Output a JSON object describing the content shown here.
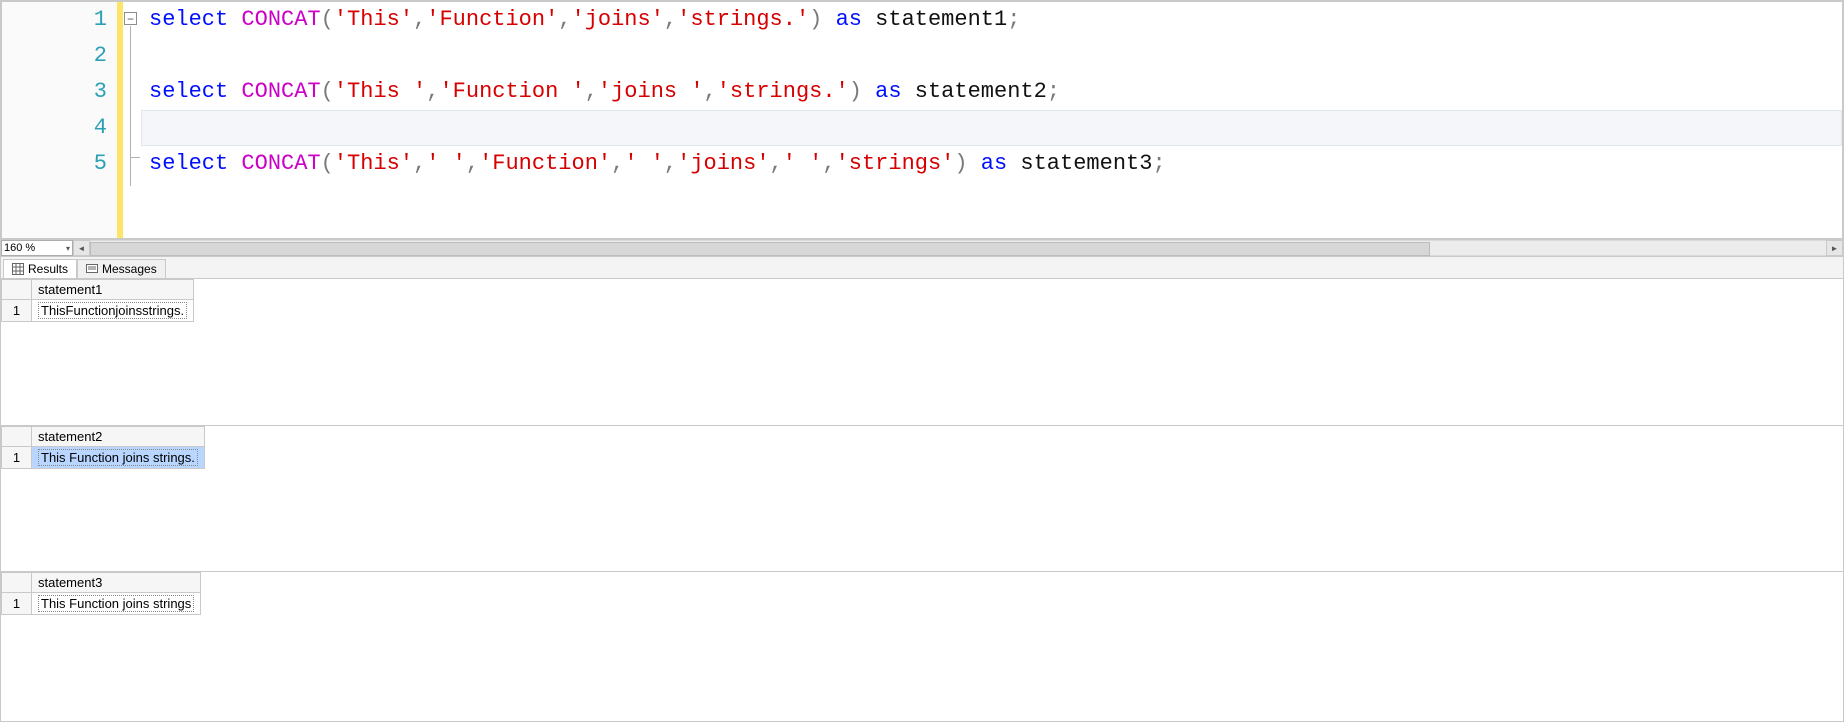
{
  "editor": {
    "zoom": "160 %",
    "fold_icon": "−",
    "lines": [
      {
        "n": "1",
        "tokens": [
          {
            "t": "select",
            "c": "kw"
          },
          {
            "t": " ",
            "c": ""
          },
          {
            "t": "CONCAT",
            "c": "fn"
          },
          {
            "t": "(",
            "c": "pn"
          },
          {
            "t": "'This'",
            "c": "str"
          },
          {
            "t": ",",
            "c": "pn"
          },
          {
            "t": "'Function'",
            "c": "str"
          },
          {
            "t": ",",
            "c": "pn"
          },
          {
            "t": "'joins'",
            "c": "str"
          },
          {
            "t": ",",
            "c": "pn"
          },
          {
            "t": "'strings.'",
            "c": "str"
          },
          {
            "t": ")",
            "c": "pn"
          },
          {
            "t": " ",
            "c": ""
          },
          {
            "t": "as",
            "c": "kw"
          },
          {
            "t": " ",
            "c": ""
          },
          {
            "t": "statement1",
            "c": "id"
          },
          {
            "t": ";",
            "c": "op"
          }
        ]
      },
      {
        "n": "2",
        "tokens": []
      },
      {
        "n": "3",
        "tokens": [
          {
            "t": "select",
            "c": "kw"
          },
          {
            "t": " ",
            "c": ""
          },
          {
            "t": "CONCAT",
            "c": "fn"
          },
          {
            "t": "(",
            "c": "pn"
          },
          {
            "t": "'This '",
            "c": "str"
          },
          {
            "t": ",",
            "c": "pn"
          },
          {
            "t": "'Function '",
            "c": "str"
          },
          {
            "t": ",",
            "c": "pn"
          },
          {
            "t": "'joins '",
            "c": "str"
          },
          {
            "t": ",",
            "c": "pn"
          },
          {
            "t": "'strings.'",
            "c": "str"
          },
          {
            "t": ")",
            "c": "pn"
          },
          {
            "t": " ",
            "c": ""
          },
          {
            "t": "as",
            "c": "kw"
          },
          {
            "t": " ",
            "c": ""
          },
          {
            "t": "statement2",
            "c": "id"
          },
          {
            "t": ";",
            "c": "op"
          }
        ]
      },
      {
        "n": "4",
        "tokens": [],
        "current": true
      },
      {
        "n": "5",
        "tokens": [
          {
            "t": "select",
            "c": "kw"
          },
          {
            "t": " ",
            "c": ""
          },
          {
            "t": "CONCAT",
            "c": "fn"
          },
          {
            "t": "(",
            "c": "pn"
          },
          {
            "t": "'This'",
            "c": "str"
          },
          {
            "t": ",",
            "c": "pn"
          },
          {
            "t": "' '",
            "c": "str"
          },
          {
            "t": ",",
            "c": "pn"
          },
          {
            "t": "'Function'",
            "c": "str"
          },
          {
            "t": ",",
            "c": "pn"
          },
          {
            "t": "' '",
            "c": "str"
          },
          {
            "t": ",",
            "c": "pn"
          },
          {
            "t": "'joins'",
            "c": "str"
          },
          {
            "t": ",",
            "c": "pn"
          },
          {
            "t": "' '",
            "c": "str"
          },
          {
            "t": ",",
            "c": "pn"
          },
          {
            "t": "'strings'",
            "c": "str"
          },
          {
            "t": ")",
            "c": "pn"
          },
          {
            "t": " ",
            "c": ""
          },
          {
            "t": "as",
            "c": "kw"
          },
          {
            "t": " ",
            "c": ""
          },
          {
            "t": "statement3",
            "c": "id"
          },
          {
            "t": ";",
            "c": "op"
          }
        ]
      }
    ]
  },
  "tabs": {
    "results_label": "Results",
    "messages_label": "Messages"
  },
  "results": [
    {
      "header": "statement1",
      "rownum": "1",
      "value": "ThisFunctionjoinsstrings.",
      "selected": false
    },
    {
      "header": "statement2",
      "rownum": "1",
      "value": "This Function joins strings.",
      "selected": true
    },
    {
      "header": "statement3",
      "rownum": "1",
      "value": "This Function joins strings",
      "selected": false
    }
  ],
  "scroll": {
    "left_arrow": "◄",
    "right_arrow": "►"
  }
}
